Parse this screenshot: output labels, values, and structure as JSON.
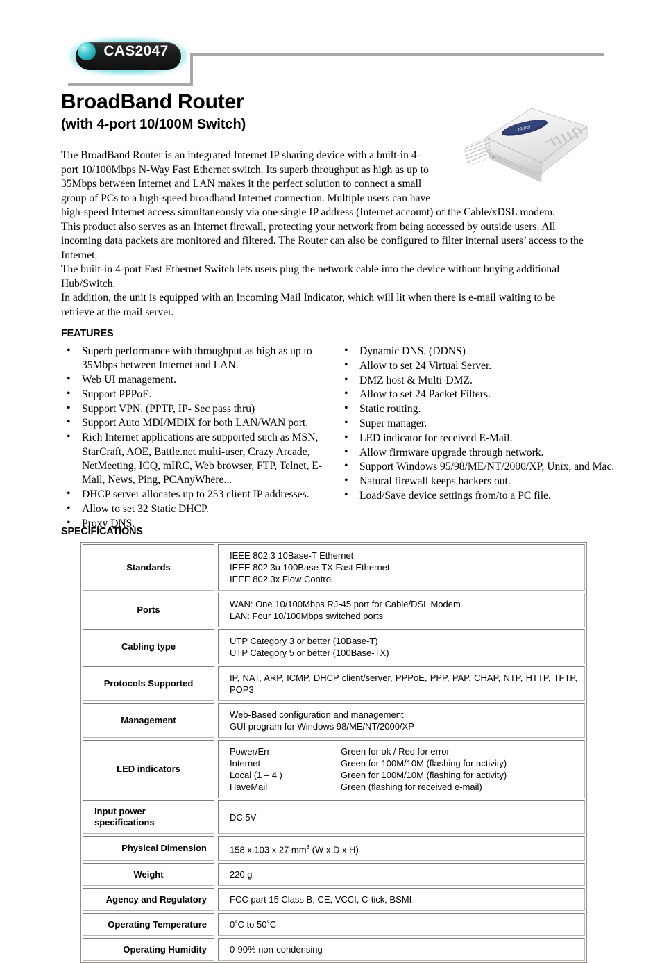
{
  "header": {
    "model_badge": "CAS2047",
    "title": "BroadBand Router",
    "subtitle": "(with 4-port 10/100M Switch)"
  },
  "intro": {
    "paragraph_1": "The BroadBand Router is an integrated Internet IP sharing device with a built-in 4-port 10/100Mbps N-Way Fast Ethernet switch. Its superb throughput as high as up to 35Mbps between Internet and LAN makes it the perfect solution to connect a small group of PCs to a high-speed broadband Internet connection. Multiple users can have high-speed Internet access simultaneously via one single IP address (Internet account) of the Cable/xDSL modem.",
    "paragraph_2": "This product also serves as an Internet firewall, protecting your network from being accessed by outside users. All incoming data packets are monitored and filtered. The Router can also be configured to filter internal users’ access to the Internet.",
    "paragraph_3": "The built-in 4-port Fast Ethernet Switch lets users plug the network cable into the device without buying additional Hub/Switch.",
    "paragraph_4": "In addition, the unit is equipped with an Incoming Mail Indicator, which will lit when there is e-mail waiting to be retrieve at the mail server."
  },
  "features": {
    "heading": "FEATURES",
    "left_items": [
      "Superb performance with throughput as high as up to 35Mbps between Internet and LAN.",
      "Web UI management.",
      "Support PPPoE.",
      "Support VPN. (PPTP, IP- Sec pass thru)",
      "Support Auto MDI/MDIX for both LAN/WAN port.",
      "Rich Internet applications are supported such as MSN, StarCraft, AOE, Battle.net multi-user, Crazy Arcade, NetMeeting, ICQ, mIRC, Web browser, FTP, Telnet, E-Mail, News, Ping, PCAnyWhere...",
      "DHCP server allocates up to 253 client IP addresses.",
      "Allow to set 32 Static DHCP.",
      "Proxy DNS."
    ],
    "right_items": [
      "Dynamic DNS. (DDNS)",
      "Allow to set 24 Virtual Server.",
      "DMZ host & Multi-DMZ.",
      "Allow to set 24 Packet Filters.",
      "Static routing.",
      "Super manager.",
      "LED indicator for received E-Mail.",
      "Allow firmware upgrade through network.",
      "Support Windows 95/98/ME/NT/2000/XP, Unix, and Mac.",
      "Natural firewall keeps hackers out.",
      "Load/Save device settings from/to a PC file."
    ]
  },
  "specifications": {
    "heading": "SPECIFICATIONS",
    "rows": [
      {
        "label": "Standards",
        "lines": [
          "IEEE 802.3 10Base-T Ethernet",
          "IEEE 802.3u 100Base-TX Fast Ethernet",
          "IEEE 802.3x Flow Control"
        ]
      },
      {
        "label": "Ports",
        "lines": [
          "WAN: One 10/100Mbps RJ-45 port for Cable/DSL Modem",
          "LAN: Four 10/100Mbps switched ports"
        ]
      },
      {
        "label": "Cabling type",
        "lines": [
          "UTP Category 3 or better (10Base-T)",
          "UTP Category 5 or better (100Base-TX)"
        ]
      },
      {
        "label": "Protocols Supported",
        "lines": [
          "IP, NAT, ARP, ICMP, DHCP client/server, PPPoE, PPP, PAP, CHAP, NTP, HTTP, TFTP, POP3"
        ]
      },
      {
        "label": "Management",
        "lines": [
          "Web-Based configuration and management",
          "GUI program for Windows 98/ME/NT/2000/XP"
        ]
      },
      {
        "label": "LED indicators",
        "led_rows": [
          {
            "name": "Power/Err",
            "desc": "Green for ok / Red for error"
          },
          {
            "name": "Internet",
            "desc": "Green for 100M/10M (flashing for activity)"
          },
          {
            "name": "Local (1 – 4 )",
            "desc": "Green for 100M/10M (flashing for activity)"
          },
          {
            "name": "HaveMail",
            "desc": "Green (flashing for received e-mail)"
          }
        ]
      },
      {
        "label": "Input power specifications",
        "lines": [
          "DC 5V"
        ]
      },
      {
        "label": "Physical Dimension",
        "lines": [
          "158 x 103 x 27 mm3 (W x D x H)"
        ]
      },
      {
        "label": "Weight",
        "lines": [
          "220 g"
        ]
      },
      {
        "label": "Agency and Regulatory",
        "lines": [
          "FCC part 15 Class B, CE, VCCI, C-tick, BSMI"
        ]
      },
      {
        "label": "Operating Temperature",
        "lines": [
          "0˚C to 50˚C"
        ]
      },
      {
        "label": "Operating Humidity",
        "lines": [
          "0-90% non-condensing"
        ]
      }
    ]
  },
  "colors": {
    "badge_glow": "#39c8cf",
    "badge_body": "#1b1b1b",
    "rule": "#a8a8a8",
    "table_border": "#8f8d86"
  }
}
